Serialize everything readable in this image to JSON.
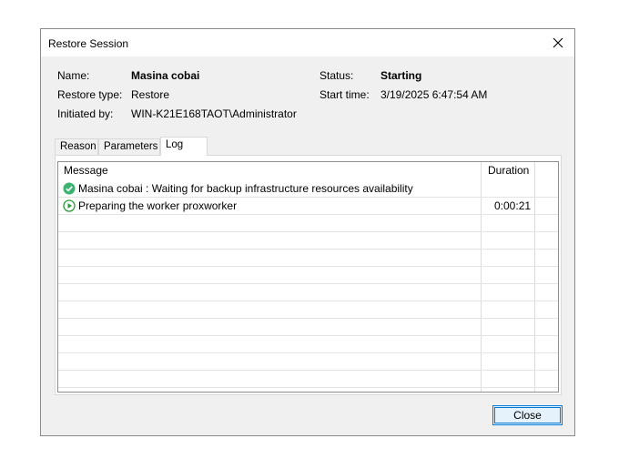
{
  "window": {
    "title": "Restore Session"
  },
  "info": {
    "name_label": "Name:",
    "name_value": "Masina cobai",
    "restore_type_label": "Restore type:",
    "restore_type_value": "Restore",
    "initiated_label": "Initiated by:",
    "initiated_value": "WIN-K21E168TAOT\\Administrator",
    "status_label": "Status:",
    "status_value": "Starting",
    "start_time_label": "Start time:",
    "start_time_value": "3/19/2025 6:47:54 AM"
  },
  "tabs": [
    {
      "label": "Reason"
    },
    {
      "label": "Parameters"
    },
    {
      "label": "Log",
      "active": true
    }
  ],
  "log": {
    "columns": {
      "message": "Message",
      "duration": "Duration"
    },
    "rows": [
      {
        "icon": "success-check-icon",
        "message": "Masina cobai : Waiting for backup infrastructure resources availability",
        "duration": ""
      },
      {
        "icon": "in-progress-play-icon",
        "message": "Preparing the worker proxworker",
        "duration": "0:00:21"
      }
    ]
  },
  "buttons": {
    "close_label": "Close"
  },
  "colors": {
    "success": "#3cb371",
    "in_progress": "#2e9a3c",
    "accent": "#0078d7"
  }
}
